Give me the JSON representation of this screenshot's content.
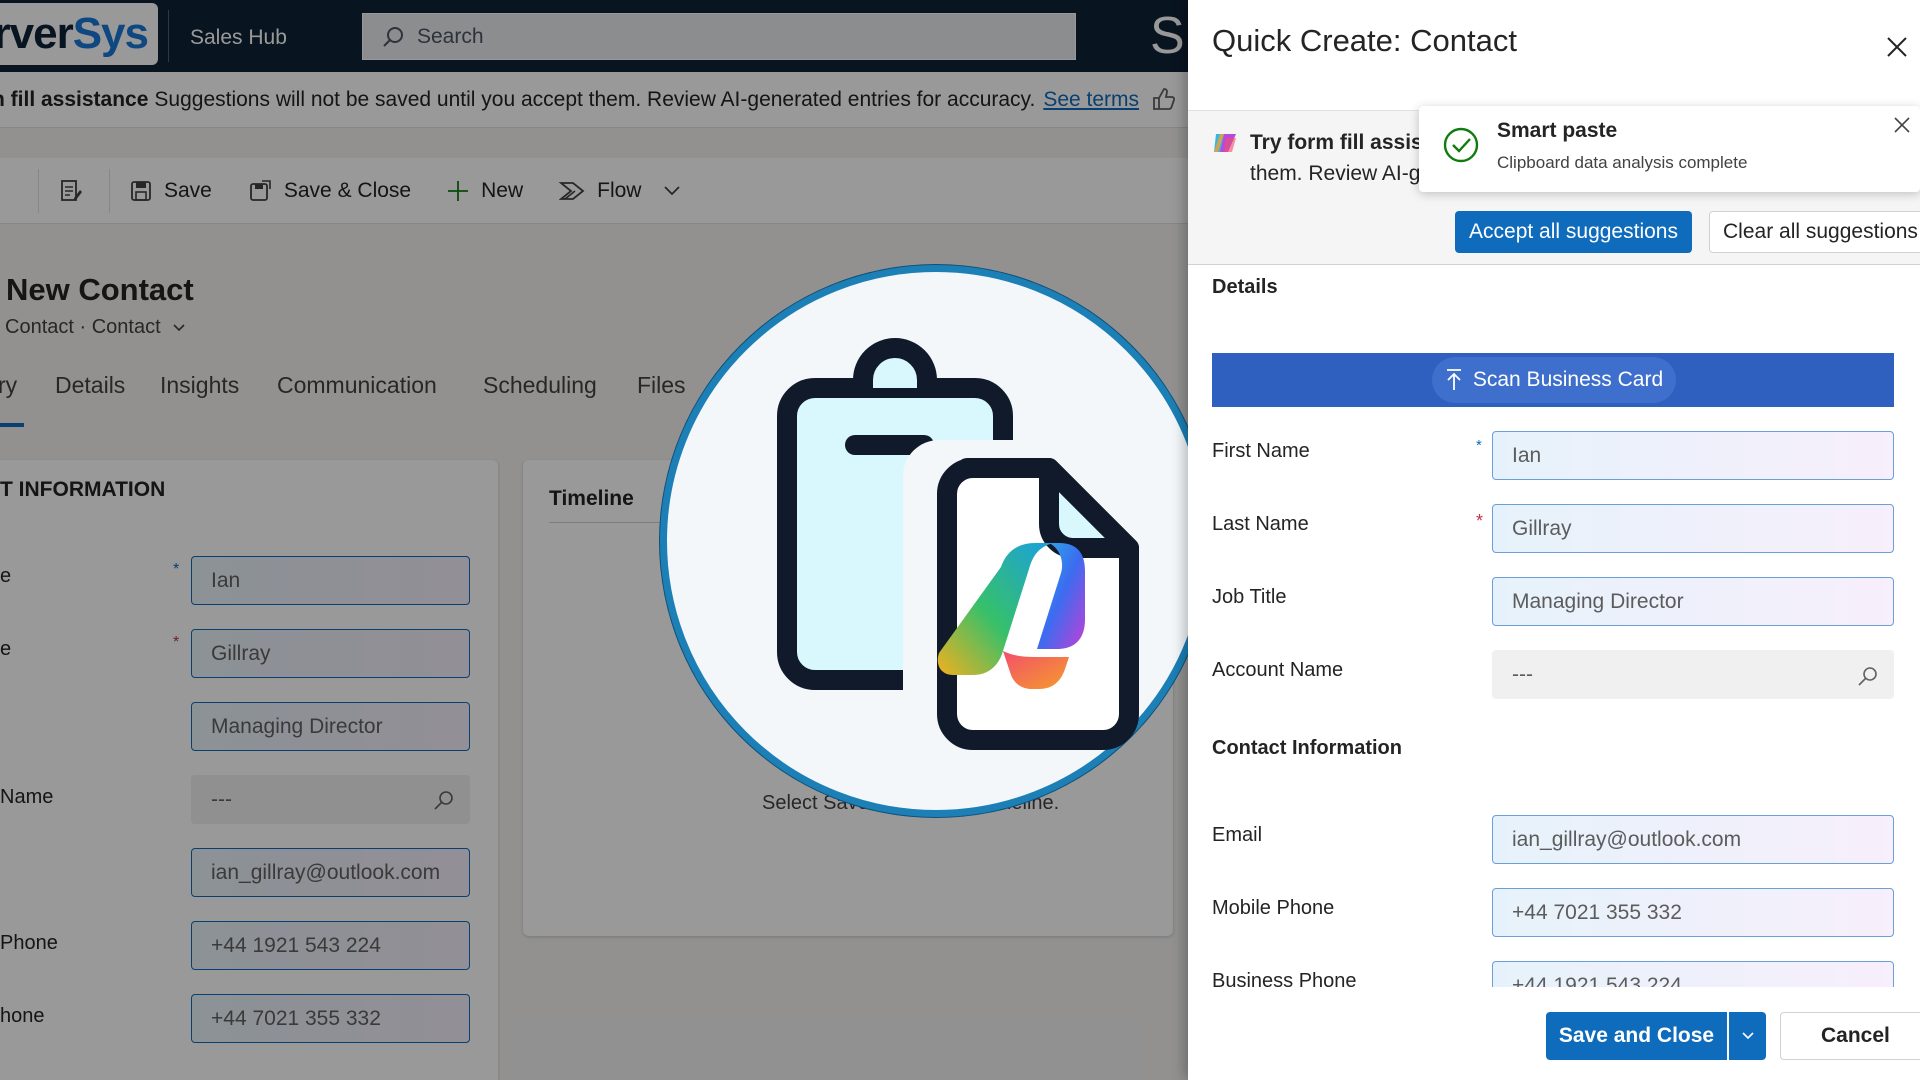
{
  "app": {
    "logo_a": "rver",
    "logo_b": "Sys",
    "name": "Sales Hub",
    "search_placeholder": "Search",
    "truncated_glyph": "S"
  },
  "notice": {
    "title": "n fill assistance",
    "text": "Suggestions will not be saved until you accept them. Review AI-generated entries for accuracy.",
    "link": "See terms"
  },
  "commands": {
    "save": "Save",
    "save_close": "Save & Close",
    "new": "New",
    "flow": "Flow"
  },
  "record": {
    "title": "New Contact",
    "subtitle": "Contact · Contact"
  },
  "bg_tabs": [
    "ry",
    "Details",
    "Insights",
    "Communication",
    "Scheduling",
    "Files"
  ],
  "bg_form": {
    "section_title": "T INFORMATION",
    "labels": [
      "e",
      "e",
      "Name",
      "Phone",
      "hone"
    ],
    "values": [
      "Ian",
      "Gillray",
      "Managing Director",
      "---",
      "ian_gillray@outlook.com",
      "+44 1921 543 224",
      "+44 7021 355 332"
    ]
  },
  "timeline": {
    "title": "Timeline",
    "empty_a": "Select Save",
    "empty_b": "meline."
  },
  "quick_create": {
    "title": "Quick Create: Contact",
    "assist_title": "Try form fill assist",
    "assist_text": "them. Review AI-g",
    "accept_all": "Accept all suggestions",
    "clear_all": "Clear all suggestions",
    "details_title": "Details",
    "scan_card": "Scan Business Card",
    "fields": [
      {
        "label": "First Name",
        "value": "Ian"
      },
      {
        "label": "Last Name",
        "value": "Gillray"
      },
      {
        "label": "Job Title",
        "value": "Managing Director"
      },
      {
        "label": "Account Name",
        "value": "---"
      }
    ],
    "contact_info_title": "Contact Information",
    "contact_fields": [
      {
        "label": "Email",
        "value": "ian_gillray@outlook.com"
      },
      {
        "label": "Mobile Phone",
        "value": "+44 7021 355 332"
      },
      {
        "label": "Business Phone",
        "value": "+44 1921 543 224"
      }
    ],
    "save_close": "Save and Close",
    "cancel": "Cancel"
  },
  "toast": {
    "title": "Smart paste",
    "body": "Clipboard data analysis complete"
  },
  "colors": {
    "brand_blue": "#0f6cbd",
    "topbar": "#0f2238",
    "scan_bar": "#2f5fbf",
    "hero_ring": "#1c7fb6",
    "required": "#c4314b",
    "success": "#107c10"
  },
  "icons": {
    "hero": "clipboard-copilot-icon",
    "toast": "checkmark-circle-icon",
    "assist": "copilot-icon"
  }
}
